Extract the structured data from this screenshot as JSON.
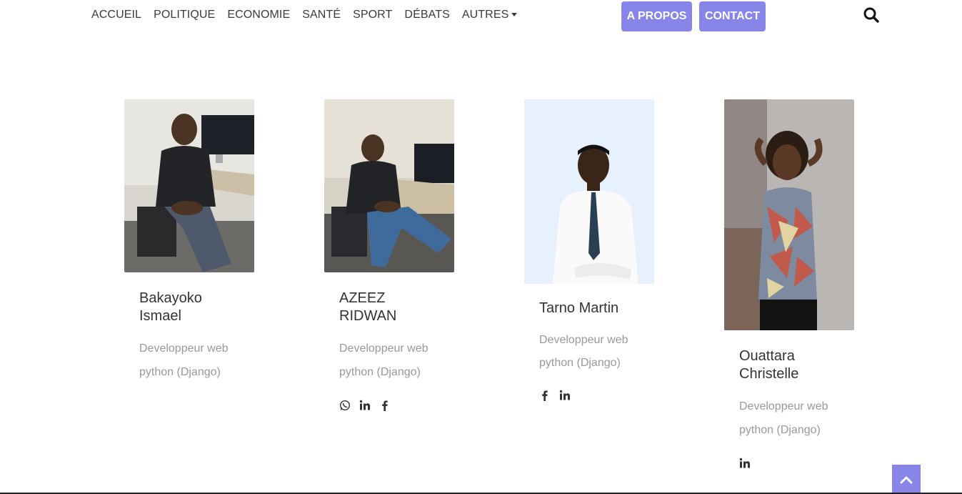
{
  "nav": {
    "links": [
      "ACCUEIL",
      "POLITIQUE",
      "ECONOMIE",
      "SANTÉ",
      "SPORT",
      "DÉBATS",
      "AUTRES"
    ],
    "about_label": "A PROPOS",
    "contact_label": "CONTACT"
  },
  "colors": {
    "accent": "#8785e8",
    "muted_text": "#999999"
  },
  "team": [
    {
      "name": "Bakayoko Ismael",
      "role": "Developpeur web python (Django)",
      "socials": []
    },
    {
      "name": "AZEEZ RIDWAN",
      "role": "Developpeur web python (Django)",
      "socials": [
        "whatsapp-icon",
        "linkedin-icon",
        "facebook-icon"
      ]
    },
    {
      "name": "Tarno Martin",
      "role": "Developpeur web python (Django)",
      "socials": [
        "facebook-icon",
        "linkedin-icon"
      ]
    },
    {
      "name": "Ouattara Christelle",
      "role": "Developpeur web python (Django)",
      "socials": [
        "linkedin-icon"
      ]
    }
  ]
}
